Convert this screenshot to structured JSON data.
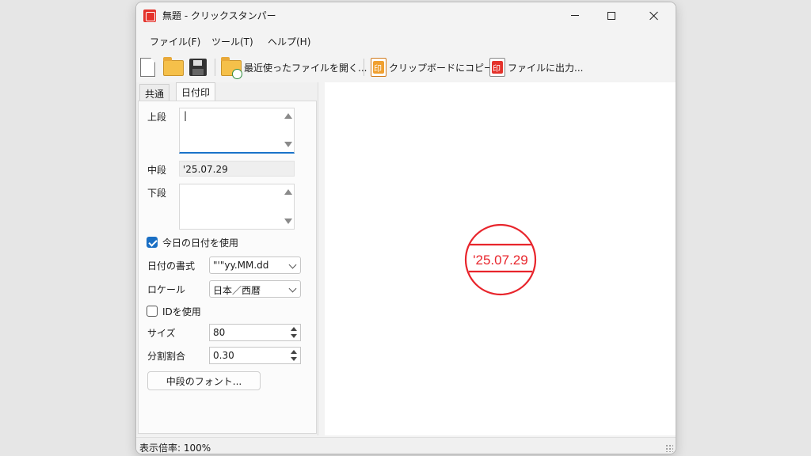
{
  "window": {
    "title": "無題 - クリックスタンパー"
  },
  "menu": [
    "ファイル(F)",
    "ツール(T)",
    "ヘルプ(H)"
  ],
  "toolbar": {
    "recent_label": "最近使ったファイルを開く...",
    "copy_label": "クリップボードにコピー",
    "export_label": "ファイルに出力..."
  },
  "tabs": {
    "common": "共通",
    "date_stamp": "日付印"
  },
  "form": {
    "upper_label": "上段",
    "upper_value": "|",
    "middle_label": "中段",
    "middle_value": "'25.07.29",
    "lower_label": "下段",
    "lower_value": "",
    "use_today_label": "今日の日付を使用",
    "use_today_checked": true,
    "date_format_label": "日付の書式",
    "date_format_value": "\"'\"yy.MM.dd",
    "locale_label": "ロケール",
    "locale_value": "日本／西暦",
    "use_id_label": "IDを使用",
    "use_id_checked": false,
    "size_label": "サイズ",
    "size_value": "80",
    "ratio_label": "分割割合",
    "ratio_value": "0.30",
    "middle_font_button": "中段のフォント..."
  },
  "preview": {
    "stamp_text": "'25.07.29",
    "stamp_color": "#e8252c"
  },
  "status": {
    "zoom": "表示倍率: 100%"
  }
}
